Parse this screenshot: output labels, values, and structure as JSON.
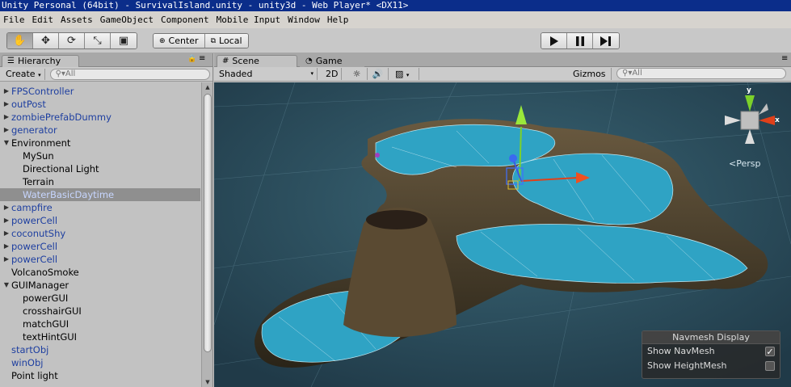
{
  "window": {
    "title": "Unity Personal (64bit) - SurvivalIsland.unity - unity3d - Web Player* <DX11>"
  },
  "menu": [
    "File",
    "Edit",
    "Assets",
    "GameObject",
    "Component",
    "Mobile Input",
    "Window",
    "Help"
  ],
  "toolbar": {
    "tools": [
      {
        "icon": "hand-icon",
        "glyph": "✋"
      },
      {
        "icon": "move-icon",
        "glyph": "✥"
      },
      {
        "icon": "rotate-icon",
        "glyph": "⟳"
      },
      {
        "icon": "scale-icon",
        "glyph": "⤡"
      },
      {
        "icon": "rect-tool-icon",
        "glyph": "▣"
      }
    ],
    "center_label": "Center",
    "local_label": "Local"
  },
  "hierarchy": {
    "tab_label": "Hierarchy",
    "create_label": "Create",
    "search_placeholder": "All",
    "items": [
      {
        "label": "FPSController",
        "indent": 0,
        "arrow": true,
        "prefab": true
      },
      {
        "label": "outPost",
        "indent": 0,
        "arrow": true,
        "prefab": true
      },
      {
        "label": "zombiePrefabDummy",
        "indent": 0,
        "arrow": true,
        "prefab": true
      },
      {
        "label": "generator",
        "indent": 0,
        "arrow": true,
        "prefab": true
      },
      {
        "label": "Environment",
        "indent": 0,
        "arrow": true,
        "expanded": true,
        "prefab": false
      },
      {
        "label": "MySun",
        "indent": 1,
        "arrow": false,
        "prefab": false
      },
      {
        "label": "Directional Light",
        "indent": 1,
        "arrow": false,
        "prefab": false
      },
      {
        "label": "Terrain",
        "indent": 1,
        "arrow": false,
        "prefab": false
      },
      {
        "label": "WaterBasicDaytime",
        "indent": 1,
        "arrow": false,
        "prefab": false,
        "selected": true
      },
      {
        "label": "campfire",
        "indent": 0,
        "arrow": true,
        "prefab": true
      },
      {
        "label": "powerCell",
        "indent": 0,
        "arrow": true,
        "prefab": true
      },
      {
        "label": "coconutShy",
        "indent": 0,
        "arrow": true,
        "prefab": true
      },
      {
        "label": "powerCell",
        "indent": 0,
        "arrow": true,
        "prefab": true
      },
      {
        "label": "powerCell",
        "indent": 0,
        "arrow": true,
        "prefab": true
      },
      {
        "label": "VolcanoSmoke",
        "indent": 0,
        "arrow": false,
        "prefab": false
      },
      {
        "label": "GUIManager",
        "indent": 0,
        "arrow": true,
        "expanded": true,
        "prefab": false
      },
      {
        "label": "powerGUI",
        "indent": 1,
        "arrow": false,
        "prefab": false
      },
      {
        "label": "crosshairGUI",
        "indent": 1,
        "arrow": false,
        "prefab": false
      },
      {
        "label": "matchGUI",
        "indent": 1,
        "arrow": false,
        "prefab": false
      },
      {
        "label": "textHintGUI",
        "indent": 1,
        "arrow": false,
        "prefab": false
      },
      {
        "label": "startObj",
        "indent": 0,
        "arrow": false,
        "prefab": true
      },
      {
        "label": "winObj",
        "indent": 0,
        "arrow": false,
        "prefab": true
      },
      {
        "label": "Point light",
        "indent": 0,
        "arrow": false,
        "prefab": false
      }
    ]
  },
  "scene": {
    "tab_scene": "Scene",
    "tab_game": "Game",
    "shading_mode": "Shaded",
    "mode_2d": "2D",
    "gizmos_label": "Gizmos",
    "search_placeholder": "All",
    "persp_label": "Persp",
    "axis_y": "y",
    "axis_x": "x"
  },
  "navmesh": {
    "title": "Navmesh Display",
    "show_navmesh_label": "Show NavMesh",
    "show_navmesh_checked": true,
    "show_heightmesh_label": "Show HeightMesh",
    "show_heightmesh_checked": false
  },
  "colors": {
    "title_bar": "#0b2d8a",
    "prefab_text": "#1e3fa0",
    "navmesh_blue": "#2fa3c4",
    "sky": "#2a4a5a"
  }
}
